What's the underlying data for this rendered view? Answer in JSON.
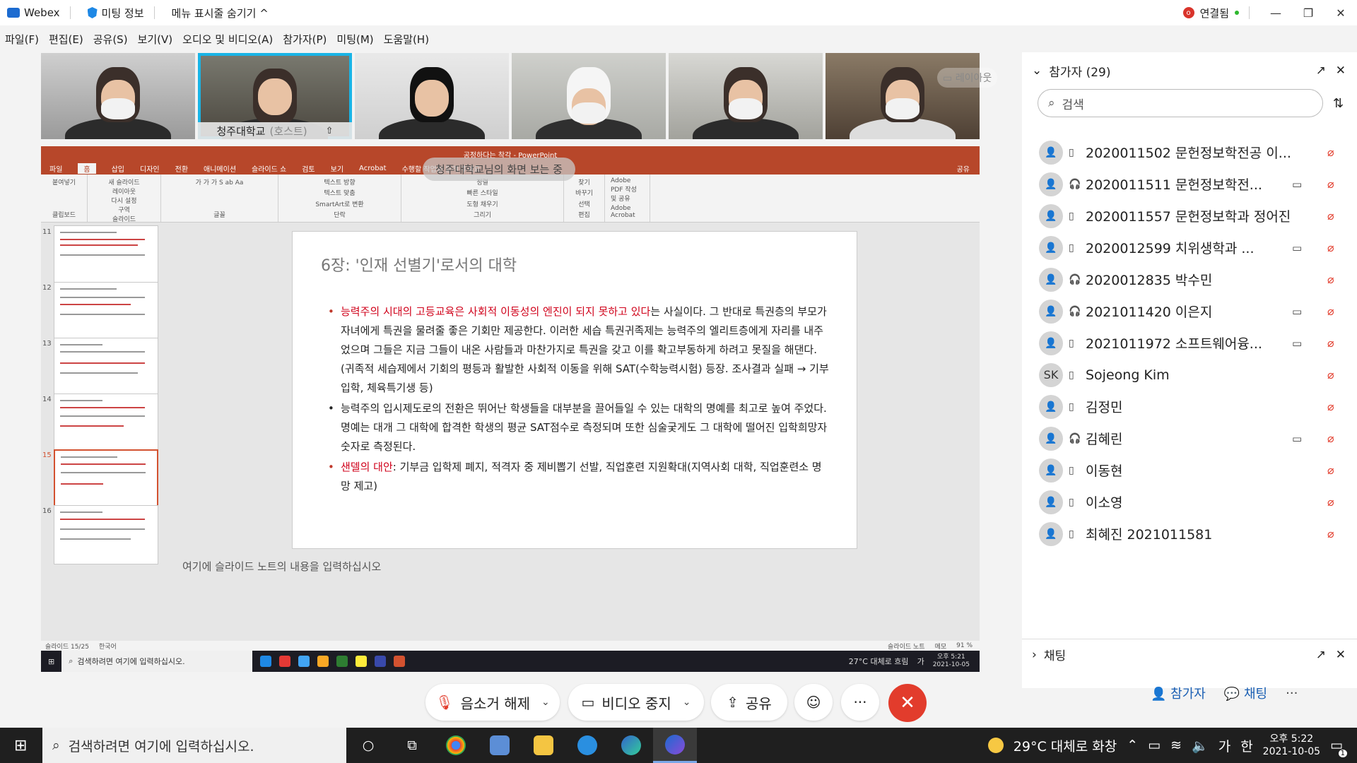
{
  "titlebar": {
    "app": "Webex",
    "meeting_info": "미팅 정보",
    "hide_menu": "메뉴 표시줄 숨기기 ^",
    "status_icon": "o",
    "status": "연결됨"
  },
  "menu": [
    "파일(F)",
    "편집(E)",
    "공유(S)",
    "보기(V)",
    "오디오 및 비디오(A)",
    "참가자(P)",
    "미팅(M)",
    "도움말(H)"
  ],
  "video": {
    "host_label": "청주대학교",
    "host_suffix": "(호스트)",
    "layout_btn": "레이아웃"
  },
  "ppt": {
    "window_title": "공정하다는 착각 - PowerPoint",
    "tabs": [
      "파일",
      "홈",
      "삽입",
      "디자인",
      "전환",
      "애니메이션",
      "슬라이드 쇼",
      "검토",
      "보기",
      "Acrobat",
      "수행할 작업을 알려 주세요"
    ],
    "share_button": "공유",
    "ribbon_groups": [
      "클립보드",
      "슬라이드",
      "글꼴",
      "단락",
      "그리기",
      "편집",
      "Adobe Acrobat"
    ],
    "ribbon_items": [
      "붙여넣기",
      "새 슬라이드",
      "레이아웃",
      "다시 설정",
      "구역",
      "텍스트 방향",
      "텍스트 맞춤",
      "SmartArt로 변환",
      "정렬",
      "빠른 스타일",
      "도형 채우기",
      "도형 윤곽선",
      "도형 효과",
      "찾기",
      "바꾸기",
      "선택",
      "Adobe PDF 작성 및 공유"
    ],
    "thumb_numbers": [
      "11",
      "12",
      "13",
      "14",
      "15",
      "16"
    ],
    "slide_title": "6장: '인재 선별기'로서의 대학",
    "b1_red": "능력주의 시대의 고등교육은 사회적 이동성의 엔진이 되지 못하고 있다",
    "b1_rest": "는 사실이다. 그 반대로 특권층의 부모가 자녀에게 특권을 물려줄 좋은 기회만 제공한다. 이러한 세습 특권귀족제는 능력주의 엘리트층에게 자리를 내주었으며 그들은 지금 그들이 내온 사람들과 마찬가지로 특권을 갖고 이를 확고부동하게 하려고 못질을 해댄다.(귀족적 세습제에서 기회의 평등과 활발한 사회적 이동을 위해 SAT(수학능력시험) 등장. 조사결과 실패 → 기부입학, 체육특기생 등)",
    "b2": "능력주의 입시제도로의 전환은 뛰어난 학생들을 대부분을 끌어들일 수 있는 대학의 명예를 최고로 높여 주었다. 명예는 대개 그 대학에 합격한 학생의 평균 SAT점수로 측정되며 또한 심술궂게도 그 대학에 떨어진 입학희망자 숫자로 측정된다.",
    "b3_red": "샌델의 대안",
    "b3_rest": ": 기부금 입학제 폐지, 적격자 중 제비뽑기 선발, 직업훈련 지원확대(지역사회 대학, 직업훈련소 명망 제고)",
    "notes": "여기에 슬라이드 노트의 내용을 입력하십시오",
    "status_slide": "슬라이드 15/25",
    "status_lang": "한국어",
    "status_notes": "슬라이드 노트",
    "status_memo": "메모",
    "status_zoom": "91 %",
    "banner": "청주대학교님의 화면 보는 중"
  },
  "inner_taskbar": {
    "search": "검색하려면 여기에 입력하십시오.",
    "weather": "27°C 대체로 흐림",
    "ime": "가",
    "time": "오후 5:21",
    "date": "2021-10-05"
  },
  "controls": {
    "mute": "음소거 해제",
    "video": "비디오 중지",
    "share": "공유"
  },
  "panel": {
    "participants_title": "참가자 (29)",
    "search_placeholder": "검색",
    "participants": [
      {
        "initial": "",
        "name": "2020011502 문헌정보학전공 이...",
        "device": "phone",
        "video": false
      },
      {
        "initial": "",
        "name": "2020011511 문헌정보학전...",
        "device": "headset",
        "video": true
      },
      {
        "initial": "",
        "name": "2020011557 문헌정보학과 정어진",
        "device": "phone",
        "video": false
      },
      {
        "initial": "",
        "name": "2020012599 치위생학과 ...",
        "device": "phone",
        "video": true
      },
      {
        "initial": "",
        "name": "2020012835 박수민",
        "device": "headset",
        "video": false
      },
      {
        "initial": "",
        "name": "2021011420 이은지",
        "device": "headset",
        "video": true
      },
      {
        "initial": "",
        "name": "2021011972 소프트웨어융...",
        "device": "phone",
        "video": true
      },
      {
        "initial": "SK",
        "name": "Sojeong Kim",
        "device": "phone",
        "video": false
      },
      {
        "initial": "",
        "name": "김정민",
        "device": "phone",
        "video": false
      },
      {
        "initial": "",
        "name": "김혜린",
        "device": "headset",
        "video": true
      },
      {
        "initial": "",
        "name": "이동현",
        "device": "phone",
        "video": false
      },
      {
        "initial": "",
        "name": "이소영",
        "device": "phone",
        "video": false
      },
      {
        "initial": "",
        "name": "최혜진 2021011581",
        "device": "phone",
        "video": false
      }
    ],
    "chat_title": "채팅",
    "btn_participants": "참가자",
    "btn_chat": "채팅"
  },
  "taskbar": {
    "search": "검색하려면 여기에 입력하십시오.",
    "weather": "29°C 대체로 화창",
    "ime": "가",
    "ime2": "한",
    "time": "오후 5:22",
    "date": "2021-10-05",
    "notif_count": "1"
  }
}
